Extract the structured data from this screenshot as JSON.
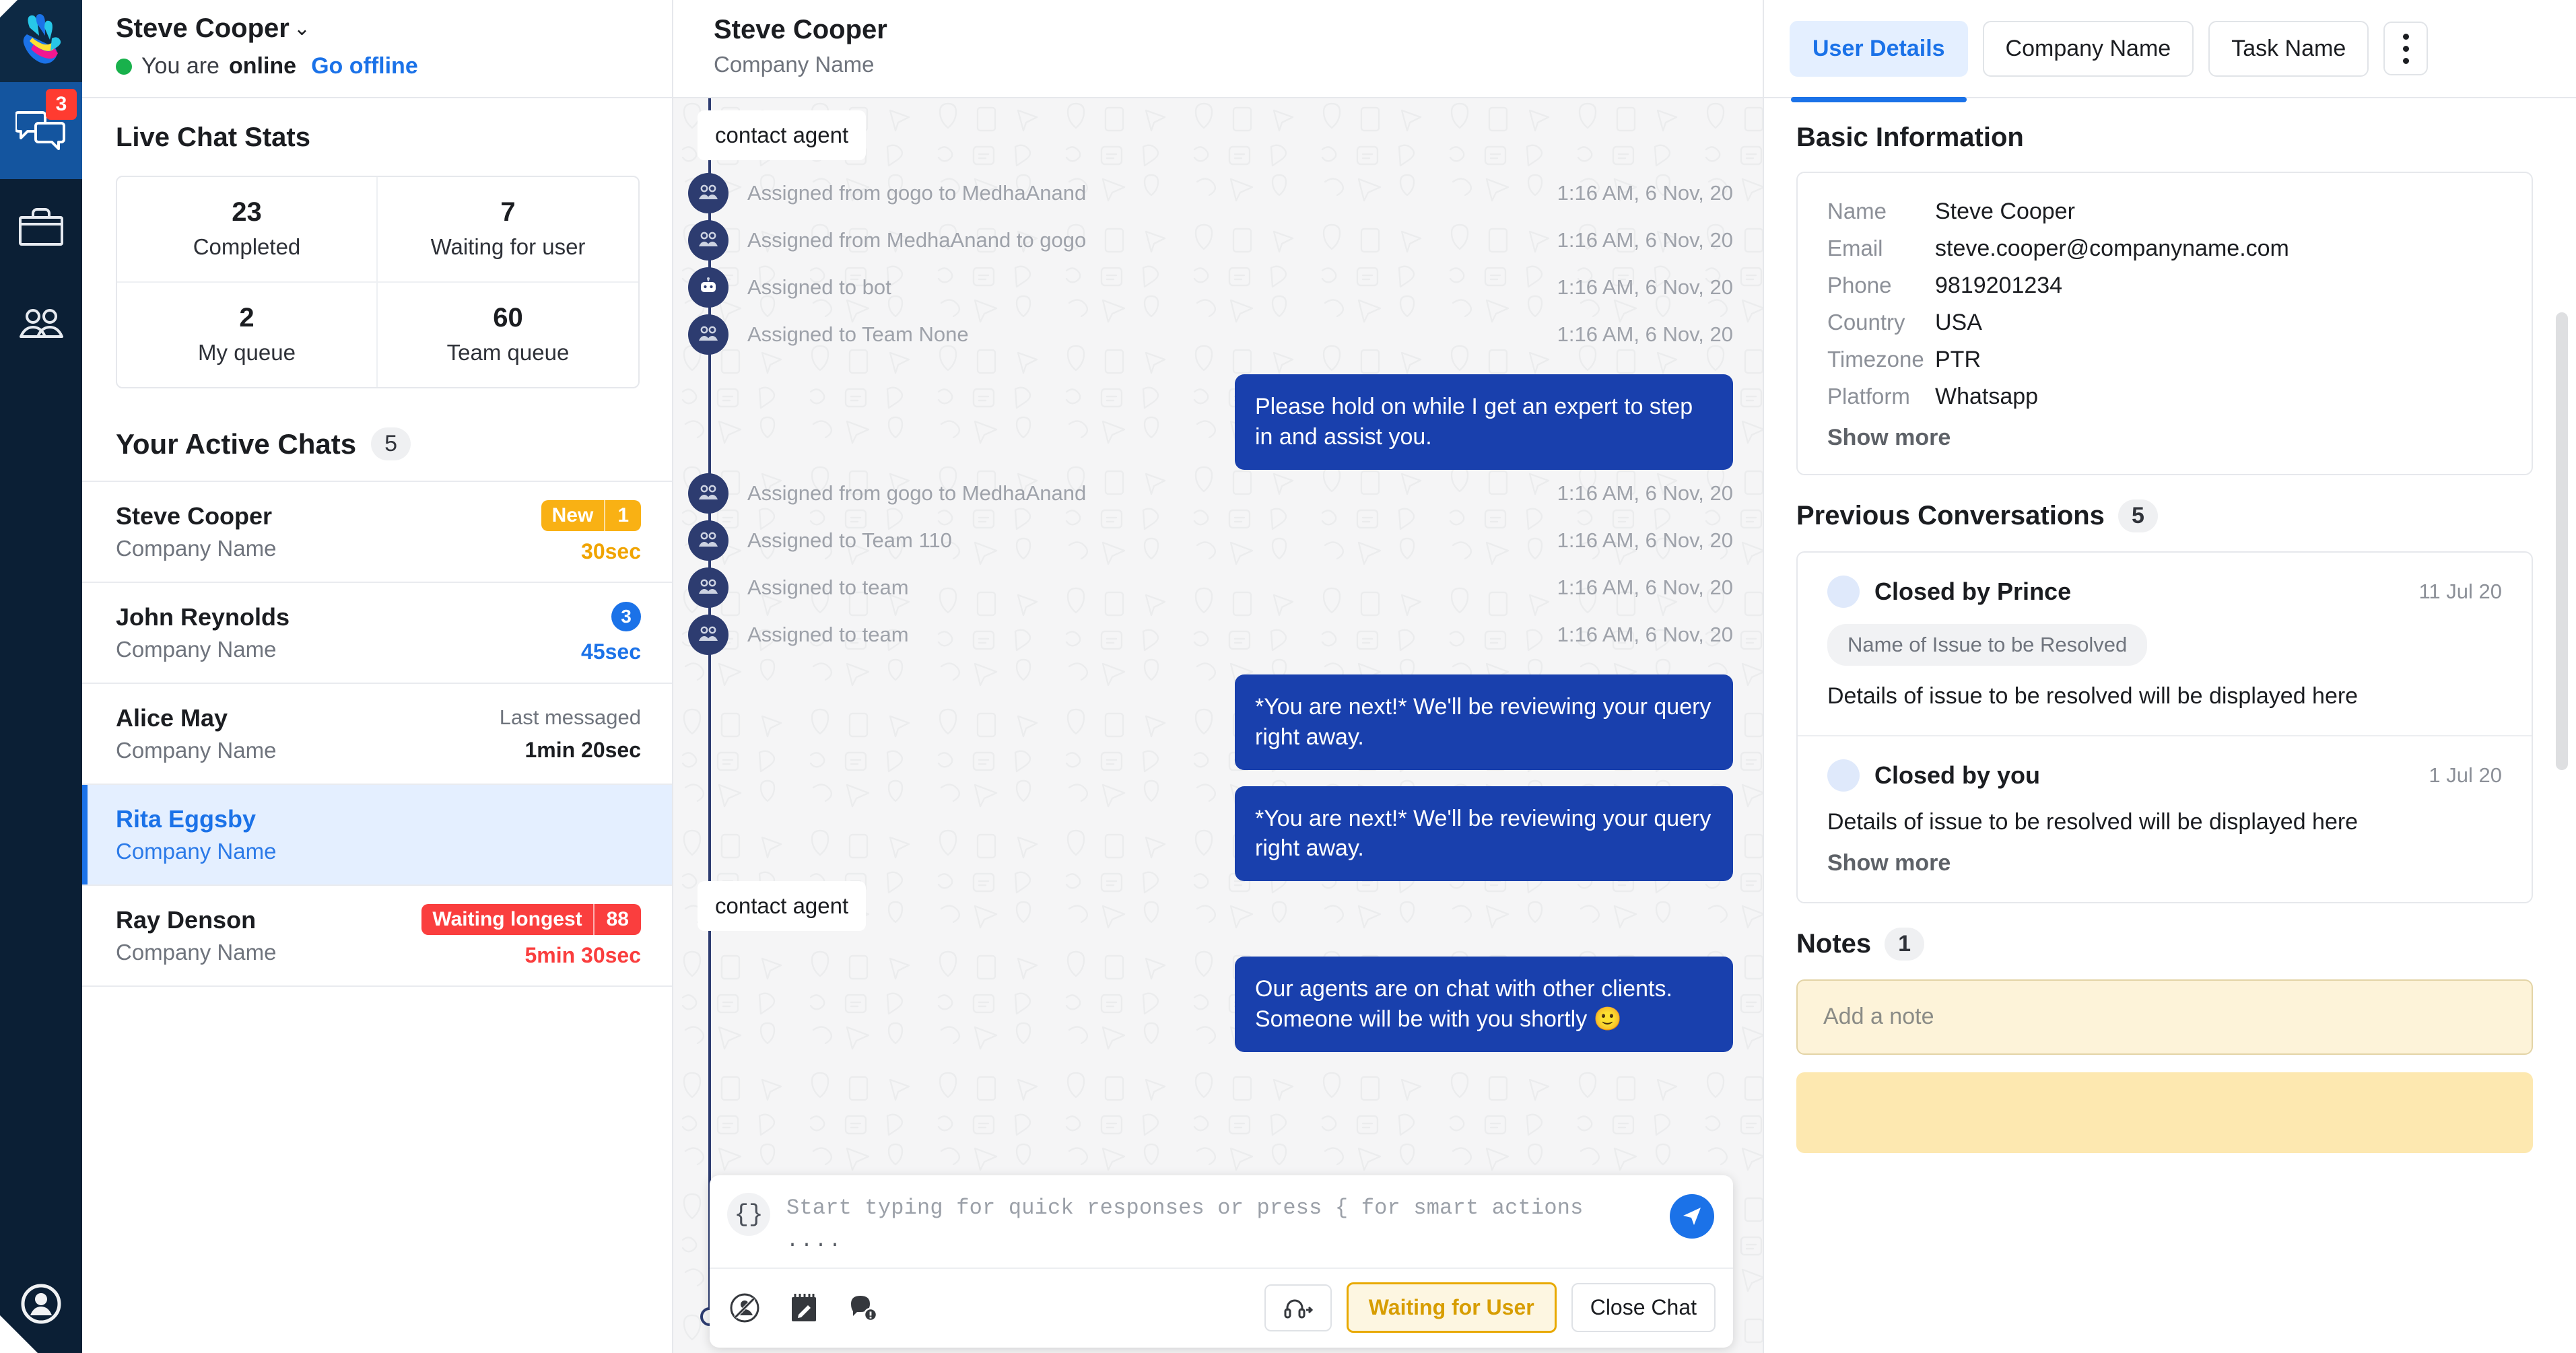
{
  "rail": {
    "logo_icon": "handshake-logo-icon",
    "items": [
      {
        "icon": "chat-bubbles-icon",
        "badge": "3",
        "active": true,
        "name": "rail-item-chats"
      },
      {
        "icon": "briefcase-icon",
        "badge": "",
        "active": false,
        "name": "rail-item-workspace"
      },
      {
        "icon": "contacts-icon",
        "badge": "",
        "active": false,
        "name": "rail-item-contacts"
      }
    ],
    "profile_icon": "user-circle-icon"
  },
  "agent": {
    "name": "Steve Cooper",
    "chevron": "⌄",
    "status_prefix": "You are",
    "status_value": "online",
    "toggle_label": "Go offline"
  },
  "stats": {
    "title": "Live Chat Stats",
    "cells": [
      {
        "value": "23",
        "label": "Completed"
      },
      {
        "value": "7",
        "label": "Waiting for user"
      },
      {
        "value": "2",
        "label": "My queue"
      },
      {
        "value": "60",
        "label": "Team queue"
      }
    ]
  },
  "active_chats": {
    "title": "Your Active Chats",
    "count": "5",
    "rows": [
      {
        "name": "Steve Cooper",
        "company": "Company Name",
        "badge_type": "amber-split",
        "badge_label": "New",
        "badge_count": "1",
        "sub": "",
        "time": "30sec",
        "time_class": "t-amber",
        "selected": false
      },
      {
        "name": "John Reynolds",
        "company": "Company Name",
        "badge_type": "blue-circle",
        "badge_label": "",
        "badge_count": "3",
        "sub": "",
        "time": "45sec",
        "time_class": "t-blue",
        "selected": false
      },
      {
        "name": "Alice May",
        "company": "Company Name",
        "badge_type": "none",
        "badge_label": "",
        "badge_count": "",
        "sub": "Last messaged",
        "time": "1min 20sec",
        "time_class": "t-dark",
        "selected": false
      },
      {
        "name": "Rita Eggsby",
        "company": "Company Name",
        "badge_type": "none",
        "badge_label": "",
        "badge_count": "",
        "sub": "",
        "time": "",
        "time_class": "t-dark",
        "selected": true
      },
      {
        "name": "Ray Denson",
        "company": "Company Name",
        "badge_type": "red-split",
        "badge_label": "Waiting longest",
        "badge_count": "88",
        "sub": "",
        "time": "5min 30sec",
        "time_class": "t-red",
        "selected": false
      }
    ]
  },
  "conversation": {
    "header_name": "Steve Cooper",
    "header_company": "Company Name",
    "items": [
      {
        "kind": "tag",
        "text": "contact agent"
      },
      {
        "kind": "event",
        "icon": "team-icon",
        "text": "Assigned from gogo to MedhaAnand",
        "time": "1:16 AM, 6 Nov, 20"
      },
      {
        "kind": "event",
        "icon": "team-icon",
        "text": "Assigned from MedhaAnand to gogo",
        "time": "1:16 AM, 6 Nov, 20"
      },
      {
        "kind": "event",
        "icon": "bot-icon",
        "text": "Assigned to bot",
        "time": "1:16 AM, 6 Nov, 20"
      },
      {
        "kind": "event",
        "icon": "team-icon",
        "text": "Assigned to Team None",
        "time": "1:16 AM, 6 Nov, 20"
      },
      {
        "kind": "out",
        "text": "Please hold on while I get an expert to step in and assist you."
      },
      {
        "kind": "event",
        "icon": "team-icon",
        "text": "Assigned from gogo to MedhaAnand",
        "time": "1:16 AM, 6 Nov, 20"
      },
      {
        "kind": "event",
        "icon": "team-icon",
        "text": "Assigned to Team 110",
        "time": "1:16 AM, 6 Nov, 20"
      },
      {
        "kind": "event",
        "icon": "team-icon",
        "text": "Assigned to team",
        "time": "1:16 AM, 6 Nov, 20"
      },
      {
        "kind": "event",
        "icon": "team-icon",
        "text": "Assigned to team",
        "time": "1:16 AM, 6 Nov, 20"
      },
      {
        "kind": "out",
        "text": "*You are next!* We'll be reviewing your query right away."
      },
      {
        "kind": "out",
        "text": "*You are next!* We'll be reviewing your query right away."
      },
      {
        "kind": "tag",
        "text": "contact agent"
      },
      {
        "kind": "out",
        "text": "Our agents are on chat with other clients. Someone will be with you shortly 🙂"
      }
    ]
  },
  "composer": {
    "braces_icon": "curly-braces-icon",
    "placeholder": "Start typing for quick responses or press { for smart actions",
    "typing_dots": "....",
    "send_icon": "send-icon",
    "tools": [
      {
        "icon": "block-user-icon",
        "name": "block-user-button"
      },
      {
        "icon": "notepad-edit-icon",
        "name": "internal-note-button"
      },
      {
        "icon": "speech-bubble-info-icon",
        "name": "canned-response-button"
      }
    ],
    "transfer_icon": "headset-add-icon",
    "waiting_label": "Waiting for User",
    "close_label": "Close Chat"
  },
  "details": {
    "tabs": [
      {
        "label": "User Details",
        "active": true
      },
      {
        "label": "Company Name",
        "active": false
      },
      {
        "label": "Task Name",
        "active": false
      }
    ],
    "kebab_icon": "more-vertical-icon",
    "basic": {
      "title": "Basic Information",
      "fields": [
        {
          "key": "Name",
          "value": "Steve Cooper"
        },
        {
          "key": "Email",
          "value": "steve.cooper@companyname.com"
        },
        {
          "key": "Phone",
          "value": "9819201234"
        },
        {
          "key": "Country",
          "value": "USA"
        },
        {
          "key": "Timezone",
          "value": "PTR"
        },
        {
          "key": "Platform",
          "value": "Whatsapp"
        }
      ],
      "show_more": "Show more"
    },
    "previous": {
      "title": "Previous Conversations",
      "count": "5",
      "items": [
        {
          "avatar": "avatar-icon",
          "title": "Closed by Prince",
          "date": "11 Jul 20",
          "chip": "Name of Issue to be Resolved",
          "desc": "Details of issue to be resolved will be displayed here"
        },
        {
          "avatar": "avatar-icon",
          "title": "Closed by you",
          "date": "1 Jul 20",
          "chip": "",
          "desc": "Details of issue to be resolved will be displayed here"
        }
      ],
      "show_more": "Show more"
    },
    "notes": {
      "title": "Notes",
      "count": "1",
      "placeholder": "Add a note"
    }
  }
}
